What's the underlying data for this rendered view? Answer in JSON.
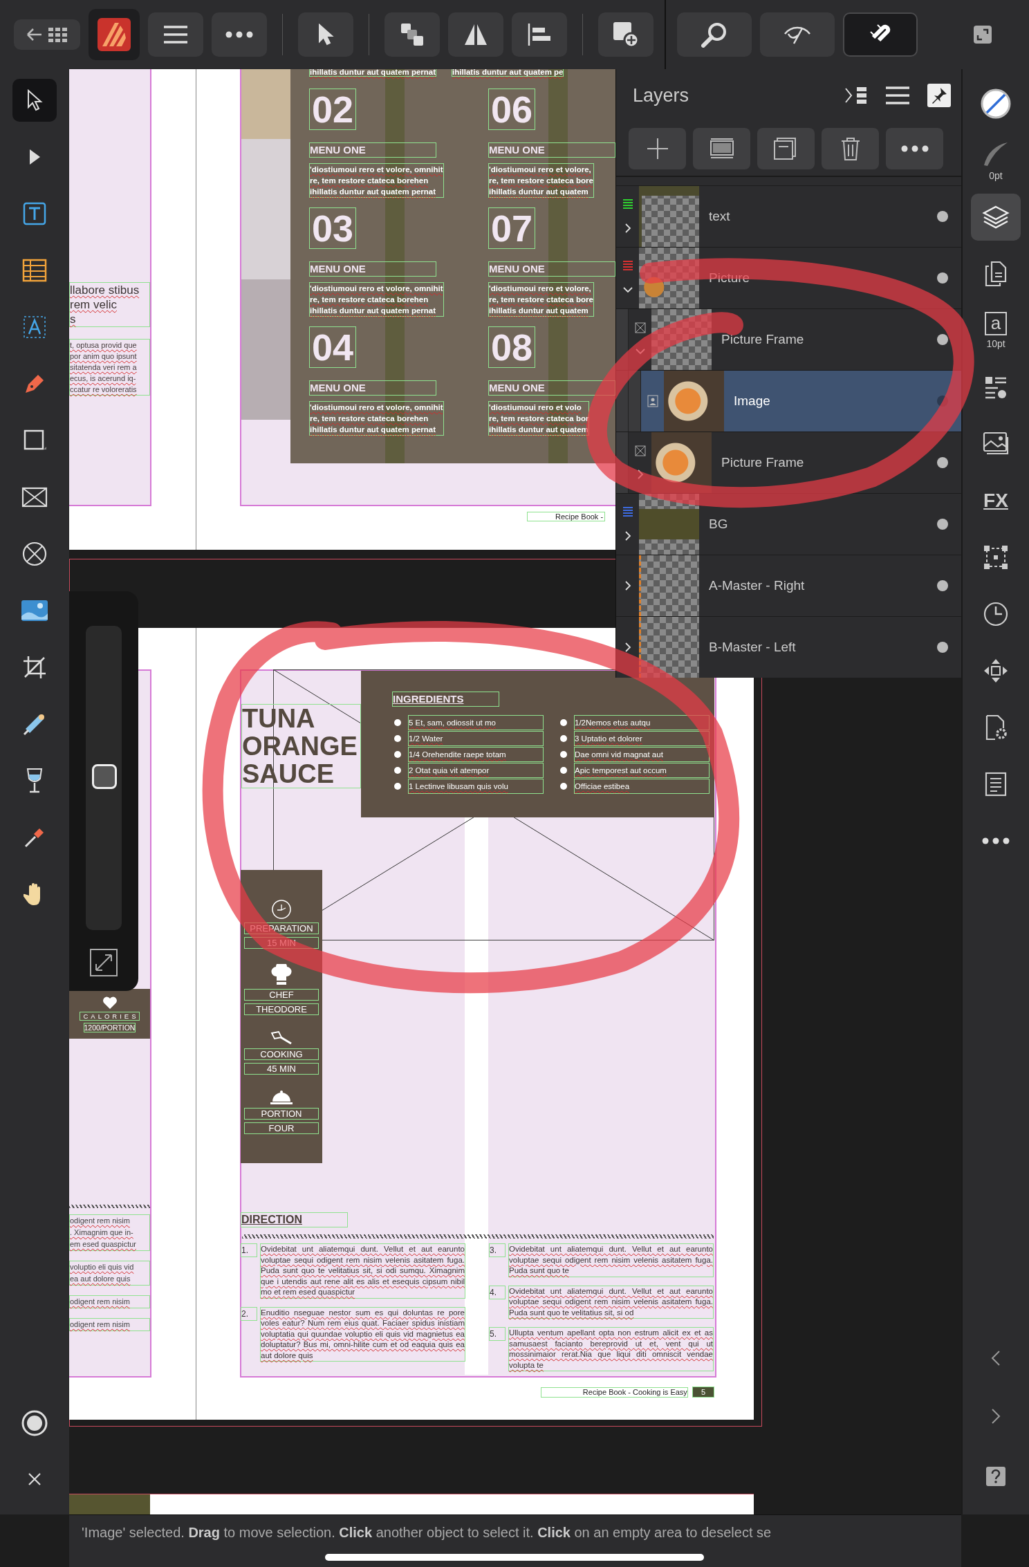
{
  "toolbar": {
    "left_groups": [
      [
        {
          "kind": "back-grid",
          "selected": false
        },
        {
          "kind": "app",
          "selected": false
        },
        {
          "kind": "menu",
          "selected": false
        },
        {
          "kind": "more",
          "selected": false
        }
      ],
      [
        {
          "kind": "pointer",
          "selected": false
        }
      ],
      [
        {
          "kind": "arrange",
          "selected": false
        },
        {
          "kind": "flip",
          "selected": false
        },
        {
          "kind": "align",
          "selected": false
        }
      ],
      [
        {
          "kind": "add-page",
          "selected": false
        }
      ]
    ],
    "right_groups": [
      [
        {
          "kind": "zoom",
          "selected": false
        },
        {
          "kind": "view",
          "selected": false
        },
        {
          "kind": "snapping",
          "selected": true
        }
      ],
      [
        {
          "kind": "fullscreen",
          "selected": false
        }
      ]
    ]
  },
  "tools": [
    {
      "kind": "move",
      "selected": true
    },
    {
      "kind": "node",
      "selected": false
    },
    {
      "kind": "text-frame",
      "selected": false
    },
    {
      "kind": "table",
      "selected": false
    },
    {
      "kind": "artistic-text",
      "selected": false
    },
    {
      "kind": "pen",
      "selected": false
    },
    {
      "kind": "rectangle",
      "selected": false
    },
    {
      "kind": "picture-frame",
      "selected": false
    },
    {
      "kind": "ellipse-frame",
      "selected": false
    },
    {
      "kind": "place-image",
      "selected": false
    },
    {
      "kind": "crop",
      "selected": false
    },
    {
      "kind": "fill",
      "selected": false
    },
    {
      "kind": "transparency",
      "selected": false
    },
    {
      "kind": "color-picker",
      "selected": false
    },
    {
      "kind": "hand",
      "selected": false
    }
  ],
  "studio": [
    {
      "kind": "stroke",
      "selected": false
    },
    {
      "kind": "brush",
      "label": "0pt",
      "selected": false
    },
    {
      "kind": "layers",
      "selected": true
    },
    {
      "kind": "pages",
      "selected": false
    },
    {
      "kind": "character",
      "glyph": "a",
      "label": "10pt",
      "selected": false
    },
    {
      "kind": "text-styles",
      "selected": false
    },
    {
      "kind": "resources",
      "selected": false
    },
    {
      "kind": "fx",
      "glyph": "FX",
      "selected": false
    },
    {
      "kind": "transform",
      "selected": false
    },
    {
      "kind": "history",
      "selected": false
    },
    {
      "kind": "navigator",
      "selected": false
    },
    {
      "kind": "preflight",
      "selected": false
    },
    {
      "kind": "document",
      "selected": false
    },
    {
      "kind": "more",
      "selected": false
    }
  ],
  "layers": {
    "title": "Layers",
    "items": [
      {
        "name": "text",
        "kind": "layer",
        "color": "#2fcf2f",
        "thumbnail": {
          "kind": "text"
        },
        "expanded": false,
        "selected": false
      },
      {
        "name": "Picture",
        "kind": "layer",
        "color": "#d83030",
        "thumbnail": {
          "kind": "photo-corner"
        },
        "expanded": true,
        "selected": false,
        "children": [
          {
            "name": "Picture Frame",
            "kind": "frame",
            "thumbnail": {
              "kind": "checker"
            },
            "expanded": true,
            "selected": false,
            "children": [
              {
                "name": "Image",
                "kind": "image",
                "thumbnail": {
                  "kind": "photo"
                },
                "selected": true
              }
            ]
          },
          {
            "name": "Picture Frame",
            "kind": "frame",
            "thumbnail": {
              "kind": "photo"
            },
            "expanded": false,
            "selected": false
          }
        ]
      },
      {
        "name": "BG",
        "kind": "layer",
        "color": "#3d6be0",
        "thumbnail": {
          "kind": "band"
        },
        "expanded": false,
        "selected": false
      },
      {
        "name": "A-Master - Right",
        "kind": "layer",
        "thumbnail": {
          "kind": "master"
        },
        "expanded": false,
        "selected": false
      },
      {
        "name": "B-Master - Left",
        "kind": "layer",
        "thumbnail": {
          "kind": "master"
        },
        "expanded": false,
        "selected": false
      }
    ]
  },
  "upper_spread": {
    "left_heading_lines": [
      "llabore stibus",
      "rem velic",
      "s"
    ],
    "left_paragraph_lines": [
      "t, optusa provid que",
      "por anim quo ipsunt",
      "sitatenda veri rem a",
      "ecus, is acerund iq-",
      "ccatur re voloreratis"
    ],
    "top_fragments": [
      "ihillatis duntur aut quatem pernat",
      "ihillatis duntur aut quatem pe"
    ],
    "menu_items": [
      {
        "number": "02",
        "title": "MENU ONE",
        "lines": [
          "'diostiumoui rero et volore, omnihit",
          "re, tem restore ctateca borehen",
          "ihillatis duntur aut quatem pernat"
        ]
      },
      {
        "number": "06",
        "title": "MENU ONE",
        "lines": [
          "'diostiumoui rero et volore,",
          "re, tem restore ctateca bore",
          "ihillatis duntur aut quatem"
        ]
      },
      {
        "number": "03",
        "title": "MENU ONE",
        "lines": [
          "'diostiumoui rero et volore, omnihit",
          "re, tem restore ctateca borehen",
          "ihillatis duntur aut quatem pernat"
        ]
      },
      {
        "number": "07",
        "title": "MENU ONE",
        "lines": [
          "'diostiumoui rero et volore,",
          "re, tem restore ctateca bore",
          "ihillatis duntur aut quatem"
        ]
      },
      {
        "number": "04",
        "title": "MENU ONE",
        "lines": [
          "'diostiumoui rero et volore, omnihit",
          "re, tem restore ctateca borehen",
          "ihillatis duntur aut quatem pernat"
        ]
      },
      {
        "number": "08",
        "title": "MENU ONE",
        "lines": [
          "'diostiumoui rero et volo",
          "re, tem restore ctateca bor",
          "ihillatis duntur aut quatem"
        ]
      }
    ],
    "footer": "Recipe Book -"
  },
  "lower_spread": {
    "calories_label": "CALORIES",
    "calories_value": "1200/PORTION",
    "left_blocks": [
      [
        "odigent rem nisim",
        ". Ximagnim que in-",
        "em esed quaspictur"
      ],
      [
        "voluptio eli quis vid",
        "ea aut dolore quis"
      ],
      [
        "odigent rem nisim"
      ],
      [
        "odigent rem nisim"
      ]
    ],
    "title_lines": [
      "TUNA",
      "ORANGE",
      "SAUCE"
    ],
    "ingredients_title": "INGREDIENTS",
    "ingredients": [
      [
        "5 Et, sam, odiossit ut mo",
        "1/2 Water",
        "1/4 Orehendite raepe totam",
        "2 Otat quia vit atempor",
        "1 Lectinve libusam quis volu"
      ],
      [
        "1/2Nemos etus autqu",
        "3 Uptatio et dolorer",
        "Dae omni vid magnat aut",
        "Apic temporest aut occum",
        "Officiae estibea"
      ]
    ],
    "info": [
      {
        "kind": "clock",
        "label": "PREPARATION",
        "value": "15 MIN"
      },
      {
        "kind": "chef-hat",
        "label": "CHEF",
        "value": "THEODORE"
      },
      {
        "kind": "spatula",
        "label": "COOKING",
        "value": "45 MIN"
      },
      {
        "kind": "cloche",
        "label": "PORTION",
        "value": "FOUR"
      }
    ],
    "direction_title": "DIRECTION",
    "steps": [
      [
        {
          "number": "1.",
          "text": "Ovidebitat unt aliatemqui dunt. Vellut et aut earunto voluptae sequi odigent rem nisim velenis asitatem fuga. Puda sunt quo te velitatius sit, si odi sumqu. Ximagnim que i utendis aut rene alit es alis et esequis cipsum nibil mo et rem esed quaspictur"
        },
        {
          "number": "2.",
          "text": "Enuditio nseguae nestor sum es qui doluntas re pore voles eatur? Num rem eius quat. Faciaer spidus inistiam voluptatia qui quundae voluptio eli quis vid magnietus ea doluptatur? Bus mi, omni-hilite cum et od eaquia quis ea aut dolore quis"
        }
      ],
      [
        {
          "number": "3.",
          "text": "Ovidebitat unt aliatemqui dunt. Vellut et aut earunto voluptae sequi odigent rem nisim velenis asitatem fuga. Puda sunt quo te"
        },
        {
          "number": "4.",
          "text": "Ovidebitat unt aliatemqui dunt. Vellut et aut earunto voluptae sequi odigent rem nisim velenis asitatem fuga. Puda sunt quo te velitatius sit, si od"
        },
        {
          "number": "5.",
          "text": "Ullupta ventum apellant opta non estrum alicit ex et as samusaest facianto bereprovid ut et, vent qui ut mossinimaior rerat.Nia que liqui diti omniscit vendae volupta te"
        }
      ]
    ],
    "footer": "Recipe Book - Cooking is Easy",
    "page_number": "5"
  },
  "status": "'Image' selected. **Drag** to move selection. **Click** another object to select it. **Click** on an empty area to deselect se"
}
